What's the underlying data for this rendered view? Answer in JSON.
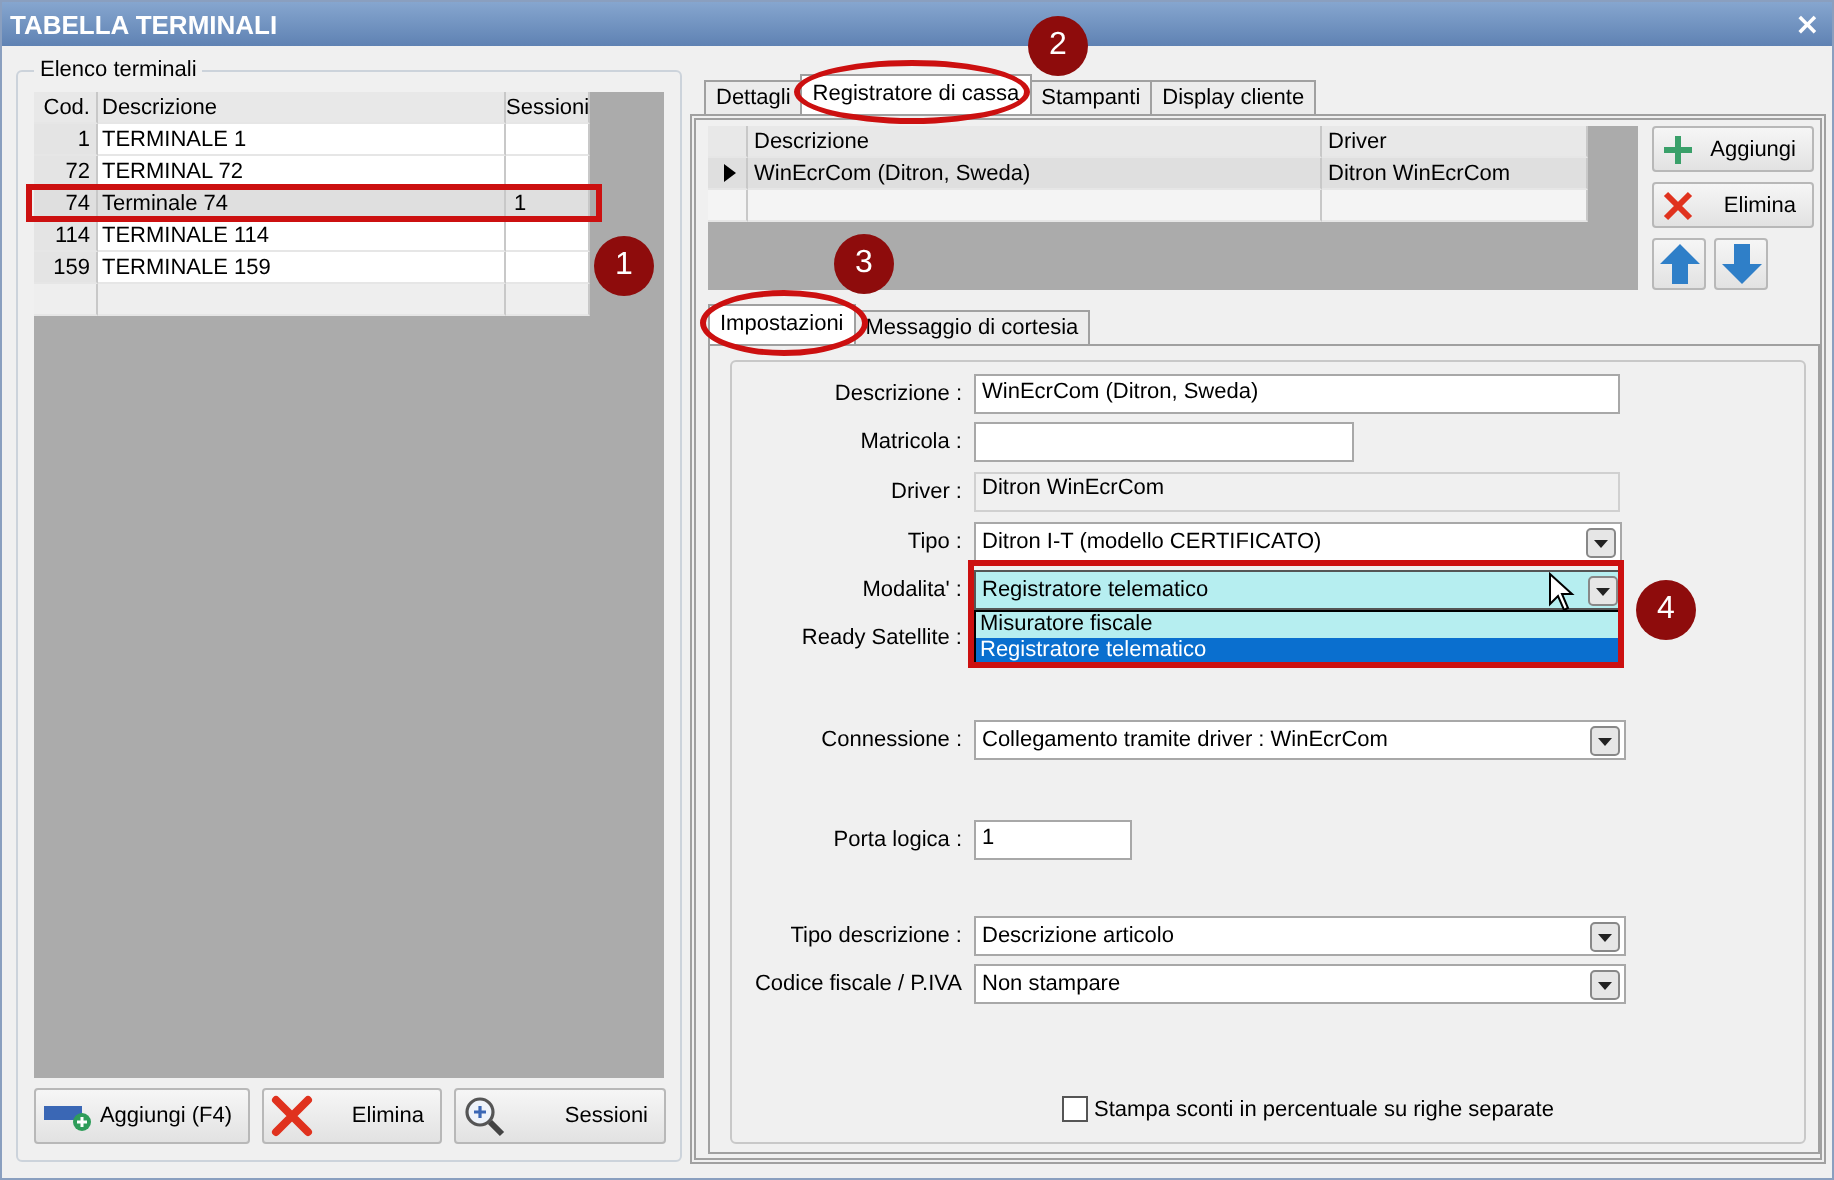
{
  "window": {
    "title": "TABELLA TERMINALI",
    "close": "×"
  },
  "terminals": {
    "group_title": "Elenco terminali",
    "columns": [
      "Cod.",
      "Descrizione",
      "Sessioni"
    ],
    "rows": [
      {
        "code": "1",
        "description": "TERMINALE 1",
        "selected": false
      },
      {
        "code": "72",
        "description": "TERMINAL 72",
        "selected": false
      },
      {
        "code": "74",
        "description": "Terminale 74",
        "sessions": "1",
        "selected": true
      },
      {
        "code": "114",
        "description": "TERMINALE 114",
        "selected": false
      },
      {
        "code": "159",
        "description": "TERMINALE 159",
        "selected": false
      }
    ],
    "buttons": [
      {
        "label": "Aggiungi (F4)",
        "kind": "add-terminal"
      },
      {
        "label": "Elimina",
        "kind": "delete"
      },
      {
        "label": "Sessioni",
        "kind": "sessions"
      }
    ]
  },
  "tabs": [
    {
      "label": "Dettagli",
      "selected": false
    },
    {
      "label": "Registratore di cassa",
      "selected": true
    },
    {
      "label": "Stampanti",
      "selected": false
    },
    {
      "label": "Display cliente",
      "selected": false
    }
  ],
  "registers": {
    "columns": [
      "Descrizione",
      "Driver"
    ],
    "rows": [
      {
        "description": "WinEcrCom (Ditron, Sweda)",
        "driver": "Ditron WinEcrCom",
        "selected": true
      }
    ],
    "buttons": [
      {
        "label": "Aggiungi",
        "kind": "add"
      },
      {
        "label": "Elimina",
        "kind": "delete"
      }
    ],
    "move_buttons": [
      {
        "kind": "up"
      },
      {
        "kind": "down"
      }
    ]
  },
  "subtabs": [
    {
      "label": "Impostazioni",
      "selected": true
    },
    {
      "label": "Messaggio di cortesia",
      "selected": false
    }
  ],
  "form": {
    "fields": [
      {
        "label": "Descrizione :",
        "kind": "text",
        "value": "WinEcrCom (Ditron, Sweda)"
      },
      {
        "label": "Matricola :",
        "kind": "text"
      },
      {
        "label": "Driver :",
        "kind": "readonly",
        "value": "Ditron WinEcrCom"
      },
      {
        "label": "Tipo :",
        "kind": "select",
        "value": "Ditron I-T (modello CERTIFICATO)",
        "expanded": false
      },
      {
        "label": "Modalita' :",
        "kind": "select",
        "value": "Registratore telematico",
        "expanded": true,
        "options": [
          {
            "label": "Misuratore fiscale",
            "selected": false
          },
          {
            "label": "Registratore telematico",
            "selected": true
          }
        ]
      },
      {
        "label": "Ready Satellite :",
        "kind": "label"
      },
      {
        "label": "Connessione :",
        "kind": "select",
        "value": "Collegamento tramite driver : WinEcrCom",
        "expanded": false
      },
      {
        "label": "Porta logica :",
        "kind": "text",
        "value": "1"
      },
      {
        "label": "Tipo descrizione :",
        "kind": "select",
        "value": "Descrizione articolo",
        "expanded": false
      },
      {
        "label": "Codice fiscale / P.IVA",
        "kind": "select",
        "value": "Non stampare",
        "expanded": false
      }
    ],
    "checkbox": {
      "label": "Stampa sconti in percentuale su righe separate",
      "checked": false
    }
  },
  "annotations": [
    {
      "label": "1",
      "kind": "rect"
    },
    {
      "label": "2",
      "kind": "ellipse"
    },
    {
      "label": "3",
      "kind": "ellipse"
    },
    {
      "label": "4",
      "kind": "rect"
    }
  ]
}
